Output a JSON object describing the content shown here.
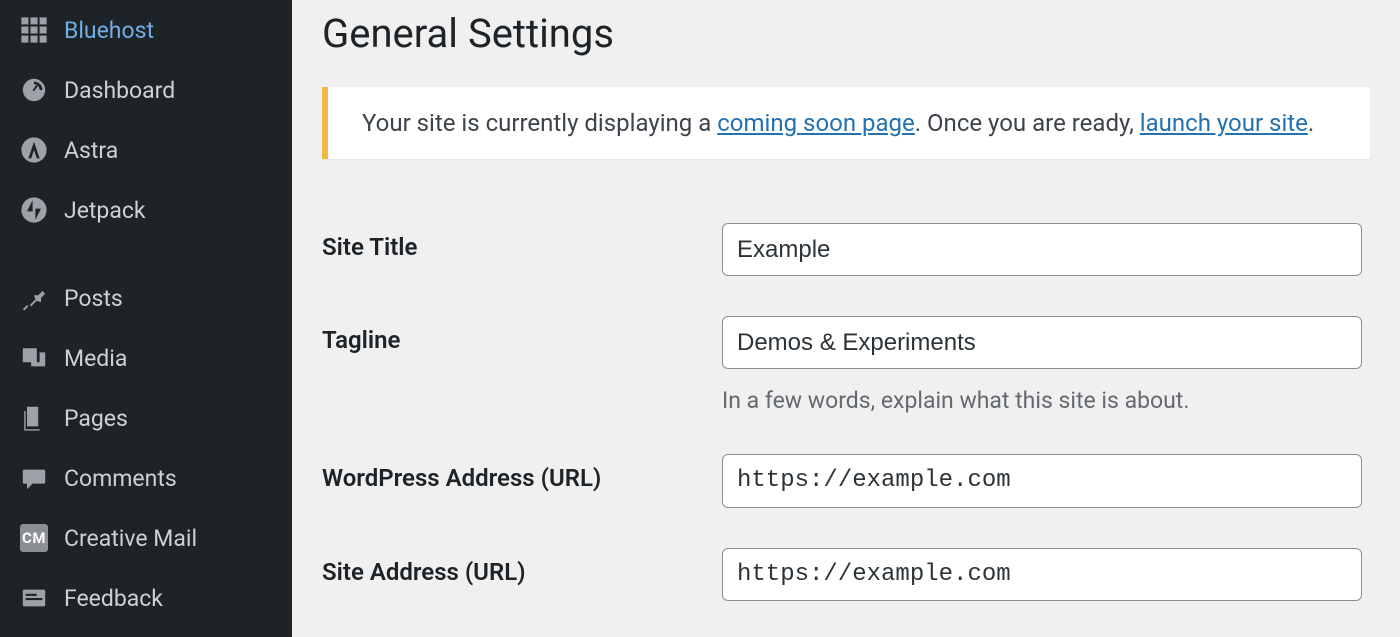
{
  "sidebar": {
    "items": [
      {
        "label": "Bluehost",
        "icon": "grid-icon"
      },
      {
        "label": "Dashboard",
        "icon": "dashboard-icon"
      },
      {
        "label": "Astra",
        "icon": "astra-icon"
      },
      {
        "label": "Jetpack",
        "icon": "jetpack-icon"
      },
      {
        "label": "Posts",
        "icon": "pin-icon"
      },
      {
        "label": "Media",
        "icon": "media-icon"
      },
      {
        "label": "Pages",
        "icon": "pages-icon"
      },
      {
        "label": "Comments",
        "icon": "comments-icon"
      },
      {
        "label": "Creative Mail",
        "icon": "cm-icon",
        "badge": "CM"
      },
      {
        "label": "Feedback",
        "icon": "feedback-icon"
      }
    ]
  },
  "page": {
    "title": "General Settings"
  },
  "notice": {
    "text_before": "Your site is currently displaying a ",
    "link1": "coming soon page",
    "text_middle": ". Once you are ready, ",
    "link2": "launch your site",
    "text_after": "."
  },
  "form": {
    "site_title": {
      "label": "Site Title",
      "value": "Example"
    },
    "tagline": {
      "label": "Tagline",
      "value": "Demos & Experiments",
      "description": "In a few words, explain what this site is about."
    },
    "wp_address": {
      "label": "WordPress Address (URL)",
      "value": "https://example.com"
    },
    "site_address": {
      "label": "Site Address (URL)",
      "value": "https://example.com"
    }
  }
}
